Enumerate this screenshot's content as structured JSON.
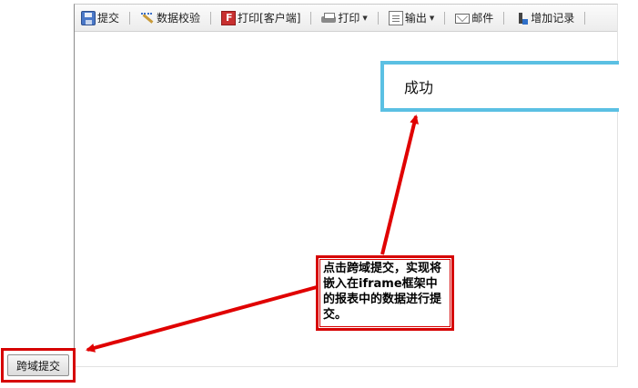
{
  "toolbar": {
    "submit": "提交",
    "validate": "数据校验",
    "print_client": "打印[客户端]",
    "print": "打印",
    "export": "输出",
    "mail": "邮件",
    "add_record": "增加记录"
  },
  "success_box": {
    "text": "成功",
    "border_color": "#5bc0e3"
  },
  "callout": {
    "text": "点击跨域提交，实现将嵌入在iframe框架中的报表中的数据进行提交。",
    "border_color": "#d60000"
  },
  "cross_domain_button": {
    "label": "跨域提交"
  },
  "icons": [
    "save-icon",
    "validate-icon",
    "flash-print-icon",
    "printer-icon",
    "export-icon",
    "mail-icon",
    "add-record-icon"
  ]
}
